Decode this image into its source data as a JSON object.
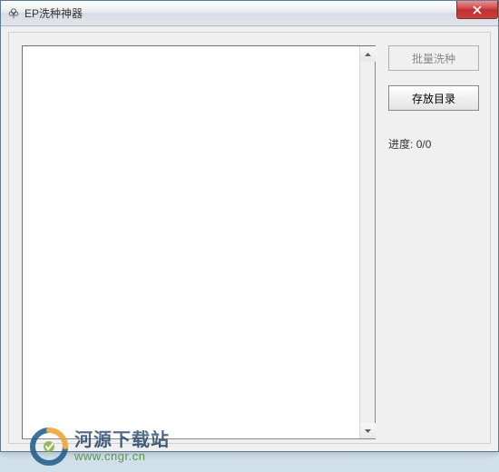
{
  "window": {
    "title": "EP洗种神器"
  },
  "buttons": {
    "batch_wash": "批量洗种",
    "save_dir": "存放目录"
  },
  "progress": {
    "label": "进度:",
    "value": "0/0"
  },
  "watermark": {
    "site_name": "河源下载站",
    "url": "www.cngr.cn"
  }
}
